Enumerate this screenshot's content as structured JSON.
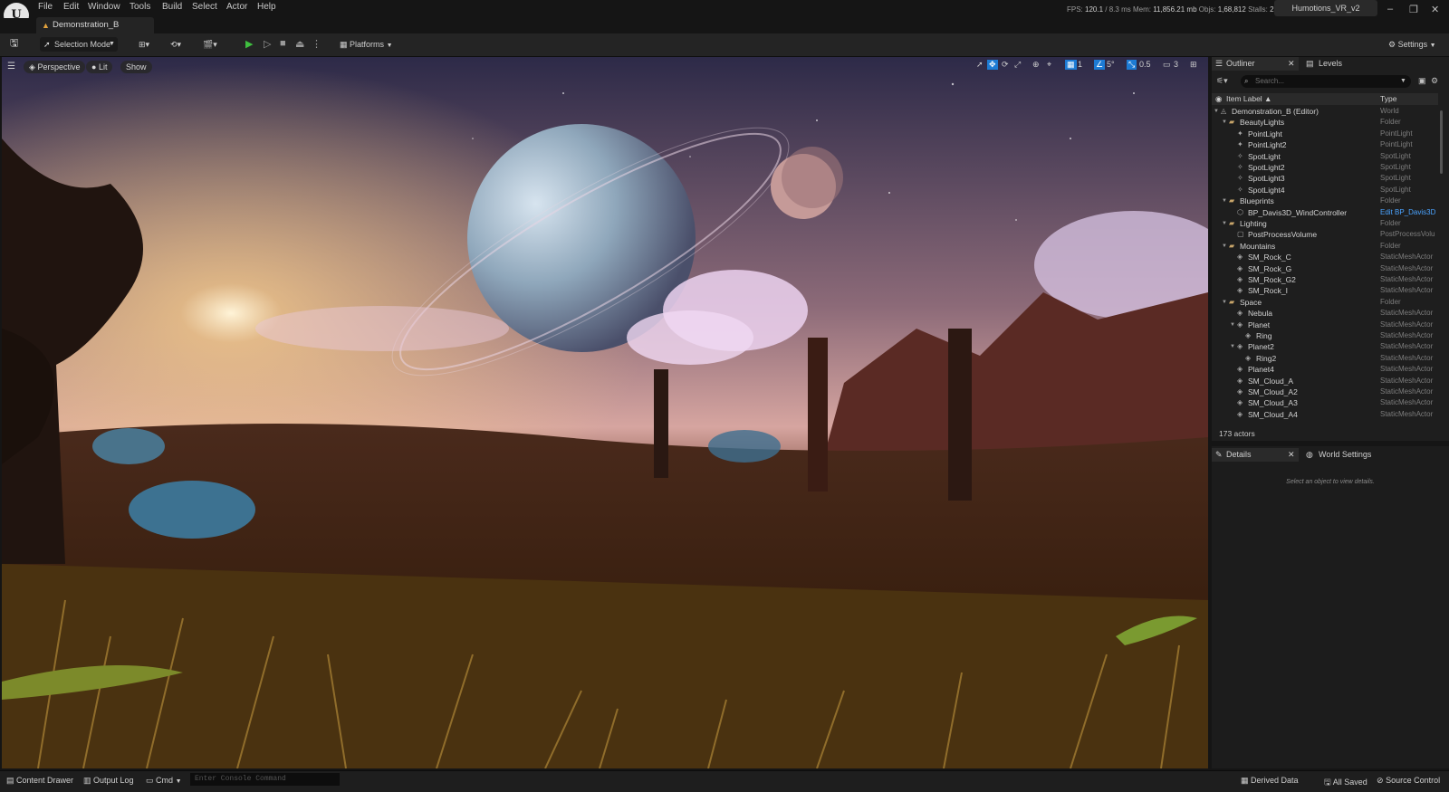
{
  "menu": [
    "File",
    "Edit",
    "Window",
    "Tools",
    "Build",
    "Select",
    "Actor",
    "Help"
  ],
  "stats": {
    "fps_label": "FPS:",
    "fps": "120.1",
    "ms": "/ 8.3 ms",
    "mem_label": "Mem:",
    "mem": "11,856.21 mb",
    "objs_label": "Objs:",
    "objs": "1,68,812",
    "stalls_label": "Stalls:",
    "stalls": "2"
  },
  "project": "Humotions_VR_v2",
  "level_tab": "Demonstration_B",
  "toolbar": {
    "selection_mode": "Selection Mode",
    "platforms": "Platforms",
    "settings": "Settings"
  },
  "viewport": {
    "perspective": "Perspective",
    "lit": "Lit",
    "show": "Show",
    "grid": "1",
    "angle": "5°",
    "scale": "0.5",
    "camera": "3"
  },
  "outliner": {
    "tab_outliner": "Outliner",
    "tab_levels": "Levels",
    "search_placeholder": "Search...",
    "col_label": "Item Label ▲",
    "col_type": "Type",
    "rows": [
      {
        "label": "Demonstration_B (Editor)",
        "type": "World",
        "depth": 0,
        "icon": "world-icon",
        "expand": true
      },
      {
        "label": "BeautyLights",
        "type": "Folder",
        "depth": 1,
        "icon": "folder-icon",
        "expand": true
      },
      {
        "label": "PointLight",
        "type": "PointLight",
        "depth": 2,
        "icon": "pointlight-icon"
      },
      {
        "label": "PointLight2",
        "type": "PointLight",
        "depth": 2,
        "icon": "pointlight-icon"
      },
      {
        "label": "SpotLight",
        "type": "SpotLight",
        "depth": 2,
        "icon": "spotlight-icon"
      },
      {
        "label": "SpotLight2",
        "type": "SpotLight",
        "depth": 2,
        "icon": "spotlight-icon"
      },
      {
        "label": "SpotLight3",
        "type": "SpotLight",
        "depth": 2,
        "icon": "spotlight-icon"
      },
      {
        "label": "SpotLight4",
        "type": "SpotLight",
        "depth": 2,
        "icon": "spotlight-icon"
      },
      {
        "label": "Blueprints",
        "type": "Folder",
        "depth": 1,
        "icon": "folder-icon",
        "expand": true
      },
      {
        "label": "BP_Davis3D_WindController",
        "type": "Edit BP_Davis3D",
        "depth": 2,
        "icon": "blueprint-icon",
        "link": true
      },
      {
        "label": "Lighting",
        "type": "Folder",
        "depth": 1,
        "icon": "folder-icon",
        "expand": true
      },
      {
        "label": "PostProcessVolume",
        "type": "PostProcessVolu",
        "depth": 2,
        "icon": "volume-icon"
      },
      {
        "label": "Mountains",
        "type": "Folder",
        "depth": 1,
        "icon": "folder-icon",
        "expand": true
      },
      {
        "label": "SM_Rock_C",
        "type": "StaticMeshActor",
        "depth": 2,
        "icon": "mesh-icon"
      },
      {
        "label": "SM_Rock_G",
        "type": "StaticMeshActor",
        "depth": 2,
        "icon": "mesh-icon"
      },
      {
        "label": "SM_Rock_G2",
        "type": "StaticMeshActor",
        "depth": 2,
        "icon": "mesh-icon"
      },
      {
        "label": "SM_Rock_I",
        "type": "StaticMeshActor",
        "depth": 2,
        "icon": "mesh-icon"
      },
      {
        "label": "Space",
        "type": "Folder",
        "depth": 1,
        "icon": "folder-icon",
        "expand": true
      },
      {
        "label": "Nebula",
        "type": "StaticMeshActor",
        "depth": 2,
        "icon": "mesh-icon"
      },
      {
        "label": "Planet",
        "type": "StaticMeshActor",
        "depth": 2,
        "icon": "mesh-icon",
        "expand": true
      },
      {
        "label": "Ring",
        "type": "StaticMeshActor",
        "depth": 3,
        "icon": "mesh-icon"
      },
      {
        "label": "Planet2",
        "type": "StaticMeshActor",
        "depth": 2,
        "icon": "mesh-icon",
        "expand": true
      },
      {
        "label": "Ring2",
        "type": "StaticMeshActor",
        "depth": 3,
        "icon": "mesh-icon"
      },
      {
        "label": "Planet4",
        "type": "StaticMeshActor",
        "depth": 2,
        "icon": "mesh-icon"
      },
      {
        "label": "SM_Cloud_A",
        "type": "StaticMeshActor",
        "depth": 2,
        "icon": "mesh-icon"
      },
      {
        "label": "SM_Cloud_A2",
        "type": "StaticMeshActor",
        "depth": 2,
        "icon": "mesh-icon"
      },
      {
        "label": "SM_Cloud_A3",
        "type": "StaticMeshActor",
        "depth": 2,
        "icon": "mesh-icon"
      },
      {
        "label": "SM_Cloud_A4",
        "type": "StaticMeshActor",
        "depth": 2,
        "icon": "mesh-icon"
      }
    ],
    "actor_count": "173 actors"
  },
  "details": {
    "tab_details": "Details",
    "tab_world": "World Settings",
    "empty": "Select an object to view details."
  },
  "statusbar": {
    "content_drawer": "Content Drawer",
    "output_log": "Output Log",
    "cmd": "Cmd",
    "console_placeholder": "Enter Console Command",
    "derived_data": "Derived Data",
    "all_saved": "All Saved",
    "source_control": "Source Control"
  },
  "colors": {
    "accent": "#1d7bd4",
    "link": "#4aa3ff",
    "folder": "#c8a56a",
    "play": "#3fbf3f"
  }
}
